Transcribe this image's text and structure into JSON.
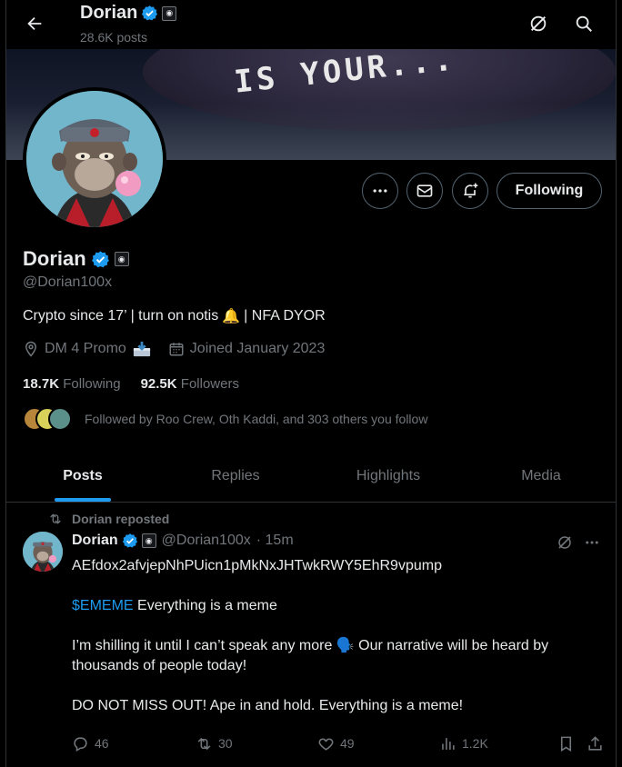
{
  "colors": {
    "accent": "#1d9bf0",
    "verified": "#1d9bf0",
    "muted": "#71767b",
    "text": "#e7e9ea",
    "bg": "#000000"
  },
  "topbar": {
    "name": "Dorian",
    "posts": "28.6K posts"
  },
  "banner": {
    "text": "IS YOUR..."
  },
  "actions": {
    "following_label": "Following"
  },
  "profile": {
    "name": "Dorian",
    "handle": "@Dorian100x",
    "bio": "Crypto since 17’ | turn on notis",
    "bio_emoji": "🔔",
    "bio_tail": "| NFA DYOR",
    "location": "DM 4 Promo",
    "joined": "Joined January 2023",
    "following_count": "18.7K",
    "following_label": "Following",
    "followers_count": "92.5K",
    "followers_label": "Followers",
    "followed_by": "Followed by Roo Crew, Oth Kaddi, and 303 others you follow"
  },
  "tabs": [
    {
      "label": "Posts",
      "active": true
    },
    {
      "label": "Replies",
      "active": false
    },
    {
      "label": "Highlights",
      "active": false
    },
    {
      "label": "Media",
      "active": false
    }
  ],
  "tweet": {
    "repost_label": "Dorian reposted",
    "name": "Dorian",
    "handle": "@Dorian100x",
    "time": "· 15m",
    "address": "AEfdox2afvjepNhPUicn1pMkNxJHTwkRWY5EhR9vpump",
    "ticker": "$EMEME",
    "line1_rest": " Everything is a meme",
    "line2": "I’m shilling it until I can’t speak any more 🗣️ Our narrative will be heard by thousands of people today!",
    "line3": "DO NOT MISS OUT! Ape in and hold. Everything is a meme!",
    "replies": "46",
    "reposts": "30",
    "likes": "49",
    "views": "1.2K"
  }
}
